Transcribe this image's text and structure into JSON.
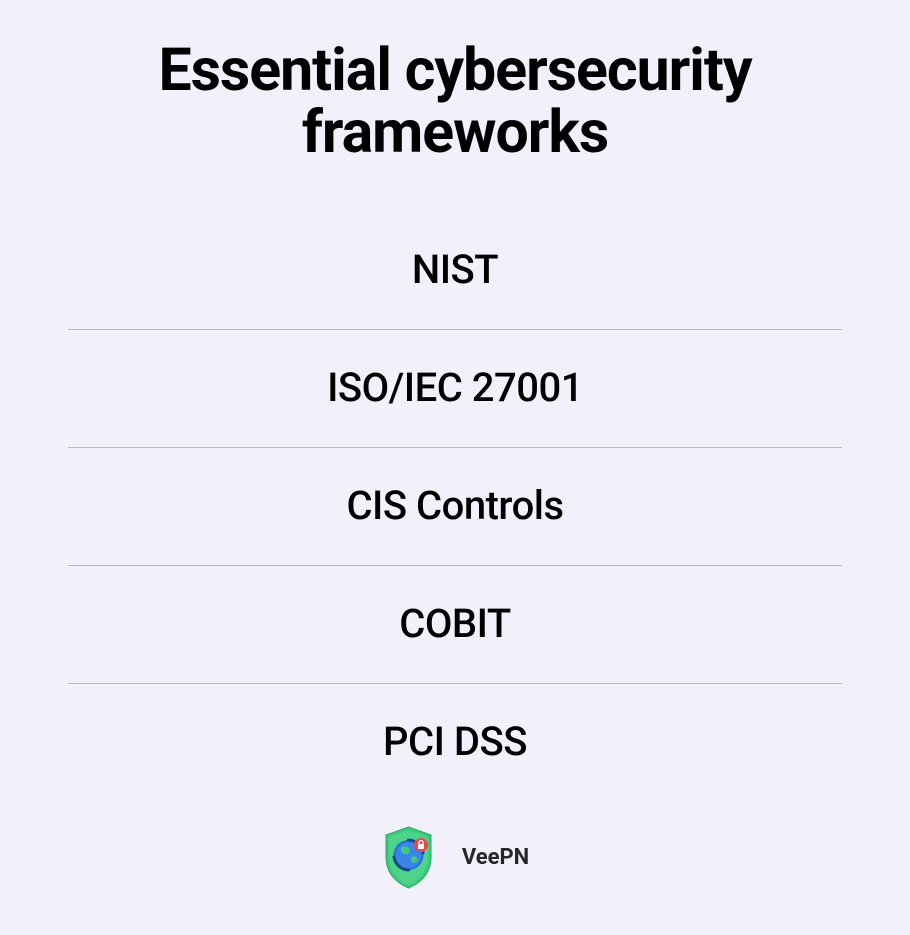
{
  "title": "Essential cybersecurity frameworks",
  "frameworks": [
    "NIST",
    "ISO/IEC 27001",
    "CIS Controls",
    "COBIT",
    "PCI DSS"
  ],
  "brand": "VeePN"
}
